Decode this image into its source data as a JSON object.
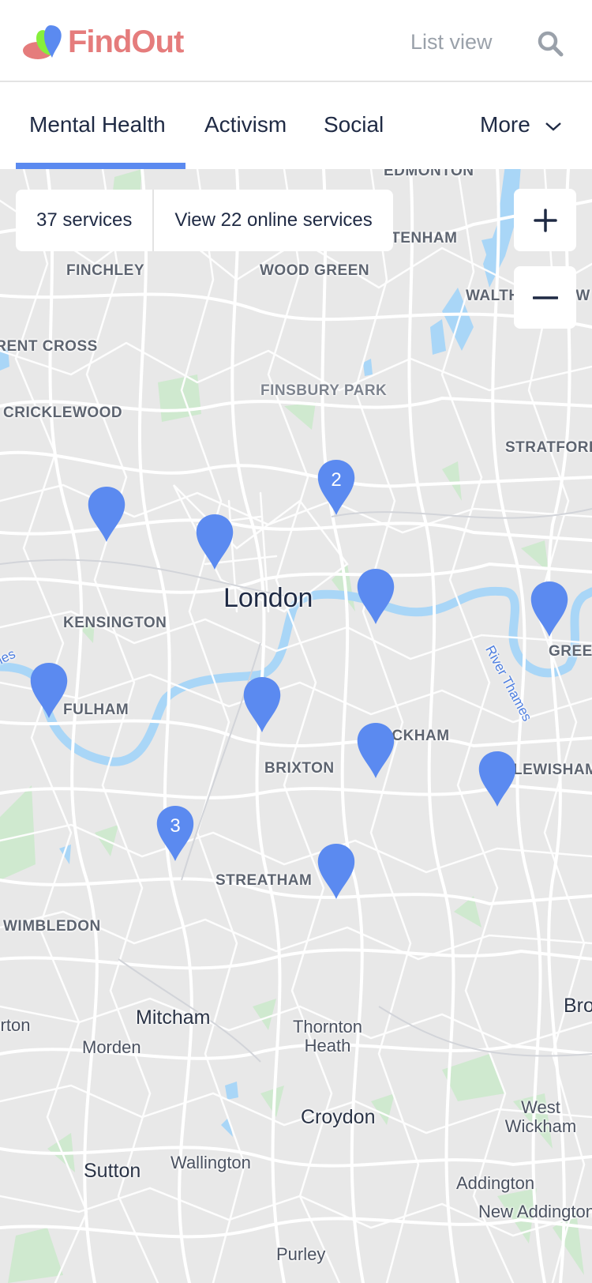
{
  "header": {
    "app_name": "FindOut",
    "list_view_label": "List view",
    "search_icon": "search-icon",
    "colors": {
      "brand": "#e57c7c",
      "accent": "#5b8af0"
    }
  },
  "tabs": {
    "items": [
      {
        "label": "Mental Health",
        "active": true
      },
      {
        "label": "Activism",
        "active": false
      },
      {
        "label": "Social",
        "active": false
      }
    ],
    "more_label": "More"
  },
  "map": {
    "services_count_label": "37 services",
    "online_services_label": "View 22 online services",
    "zoom_in_label": "+",
    "zoom_out_label": "−",
    "labels": {
      "edmonton": "EDMONTON",
      "tottenham": "TOTTENHAM",
      "finchley": "FINCHLEY",
      "wood_green": "WOOD GREEN",
      "walthamstow": "WALTHAMSTOW",
      "brent_cross": "BRENT CROSS",
      "finsbury_park": "FINSBURY PARK",
      "cricklewood": "CRICKLEWOOD",
      "stratford": "STRATFORD",
      "london": "London",
      "kensington": "KENSINGTON",
      "greenwich": "GREENWICH",
      "fulham": "FULHAM",
      "peckham": "PECKHAM",
      "brixton": "BRIXTON",
      "lewisham": "LEWISHAM",
      "streatham": "STREATHAM",
      "wimbledon": "WIMBLEDON",
      "mitcham": "Mitcham",
      "morden": "Morden",
      "thornton_heath": "Thornton Heath",
      "bromley": "Bromley",
      "croydon": "Croydon",
      "west_wickham": "West Wickham",
      "sutton": "Sutton",
      "wallington": "Wallington",
      "addington": "Addington",
      "new_addington": "New Addington",
      "purley": "Purley",
      "merton": "Merton",
      "river_thames": "River Thames",
      "thames_west": "Thames"
    },
    "markers": [
      {
        "name": "marker-cricklewood",
        "count": ""
      },
      {
        "name": "marker-camden",
        "count": ""
      },
      {
        "name": "marker-islington-cluster",
        "count": "2"
      },
      {
        "name": "marker-city",
        "count": ""
      },
      {
        "name": "marker-isle-of-dogs",
        "count": ""
      },
      {
        "name": "marker-fulham",
        "count": ""
      },
      {
        "name": "marker-vauxhall",
        "count": ""
      },
      {
        "name": "marker-peckham",
        "count": ""
      },
      {
        "name": "marker-lewisham",
        "count": ""
      },
      {
        "name": "marker-clapham-cluster",
        "count": "3"
      },
      {
        "name": "marker-streatham",
        "count": ""
      }
    ]
  }
}
